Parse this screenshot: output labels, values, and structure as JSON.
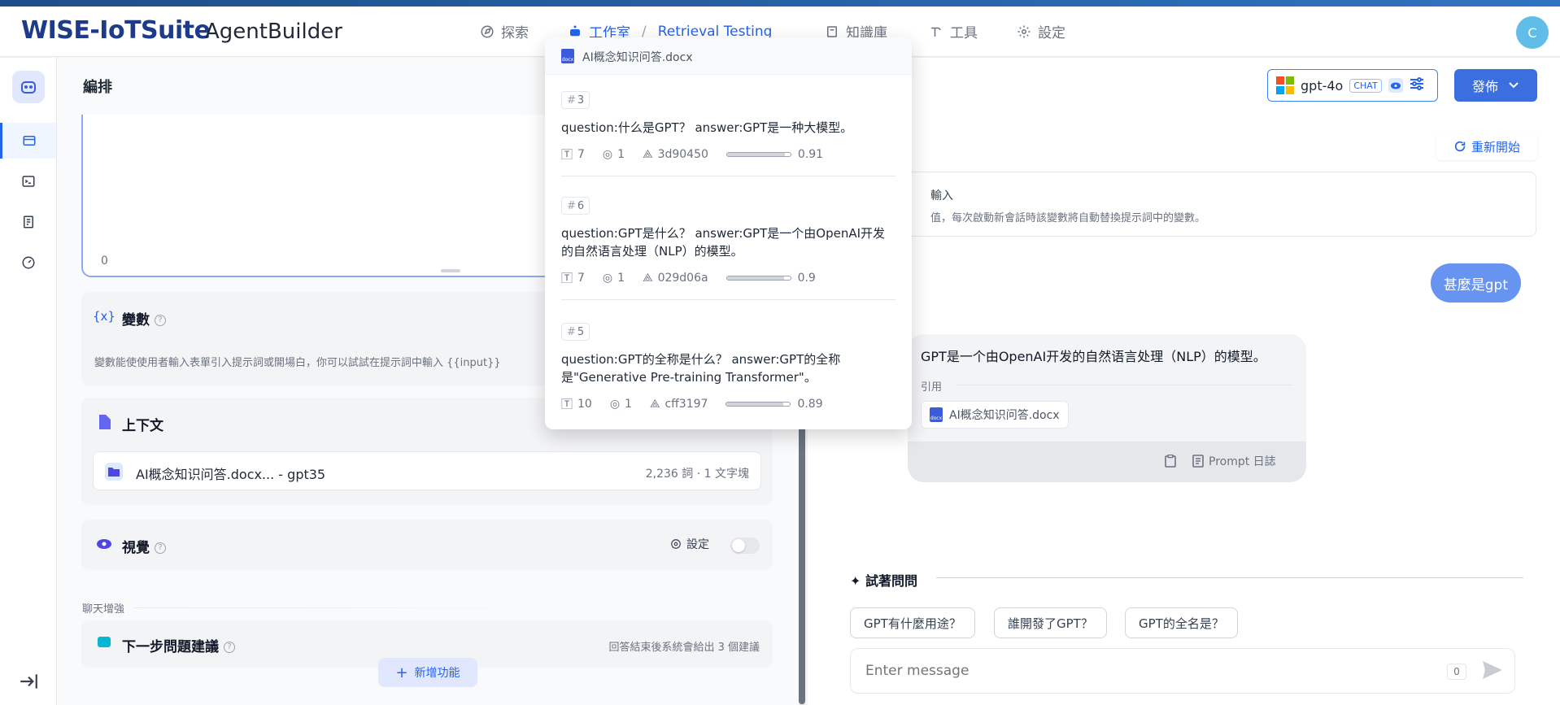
{
  "header": {
    "brand": "WISE-IoTSuite",
    "brand_sub": "AgentBuilder",
    "nav_explore": "探索",
    "nav_studio": "工作室",
    "nav_breadcrumb": "Retrieval Testing",
    "nav_knowledge": "知識庫",
    "nav_tools": "工具",
    "nav_settings": "設定",
    "avatar_initial": "C"
  },
  "left": {
    "title": "編排",
    "prompt_count": "0",
    "variables": {
      "title": "變數",
      "desc": "變數能使使用者輸入表單引入提示詞或開場白，你可以試試在提示詞中輸入 {{input}}"
    },
    "context": {
      "title": "上下文",
      "item_name": "AI概念知识问答.docx... - gpt35",
      "item_meta": "2,236 詞 · 1 文字塊"
    },
    "vision": {
      "title": "視覺",
      "setting_label": "設定"
    },
    "group_label": "聊天增強",
    "next_suggest": {
      "title": "下一步問題建議",
      "desc": "回答結束後系統會給出 3 個建議"
    },
    "add_feature": "新增功能"
  },
  "right": {
    "model_name": "gpt-4o",
    "model_tag": "CHAT",
    "publish": "發佈",
    "restart": "重新開始",
    "var_title": "輸入",
    "var_desc": "值，每次啟動新會話時該變數將自動替換提示詞中的變數。",
    "user_msg": "甚麼是gpt",
    "bot_msg": "GPT是一个由OpenAI开发的自然语言处理（NLP）的模型。",
    "cite_label": "引用",
    "cite_doc": "AI概念知识问答.docx",
    "prompt_log": "Prompt 日誌",
    "try_title": "試著問問",
    "suggestions": [
      "GPT有什麼用途？",
      "誰開發了GPT？",
      "GPT的全名是？"
    ],
    "input_placeholder": "Enter message",
    "input_count": "0"
  },
  "popover": {
    "doc_name": "AI概念知识问答.docx",
    "segments": [
      {
        "num": "3",
        "text": "question:什么是GPT？ answer:GPT是一种大模型。",
        "chars": "7",
        "hits": "1",
        "hash": "3d90450",
        "score": 0.91,
        "score_label": "0.91"
      },
      {
        "num": "6",
        "text": "question:GPT是什么？ answer:GPT是一个由OpenAI开发的自然语言处理（NLP）的模型。",
        "chars": "7",
        "hits": "1",
        "hash": "029d06a",
        "score": 0.9,
        "score_label": "0.9"
      },
      {
        "num": "5",
        "text": "question:GPT的全称是什么？ answer:GPT的全称是\"Generative Pre-training Transformer\"。",
        "chars": "10",
        "hits": "1",
        "hash": "cff3197",
        "score": 0.89,
        "score_label": "0.89"
      }
    ]
  }
}
